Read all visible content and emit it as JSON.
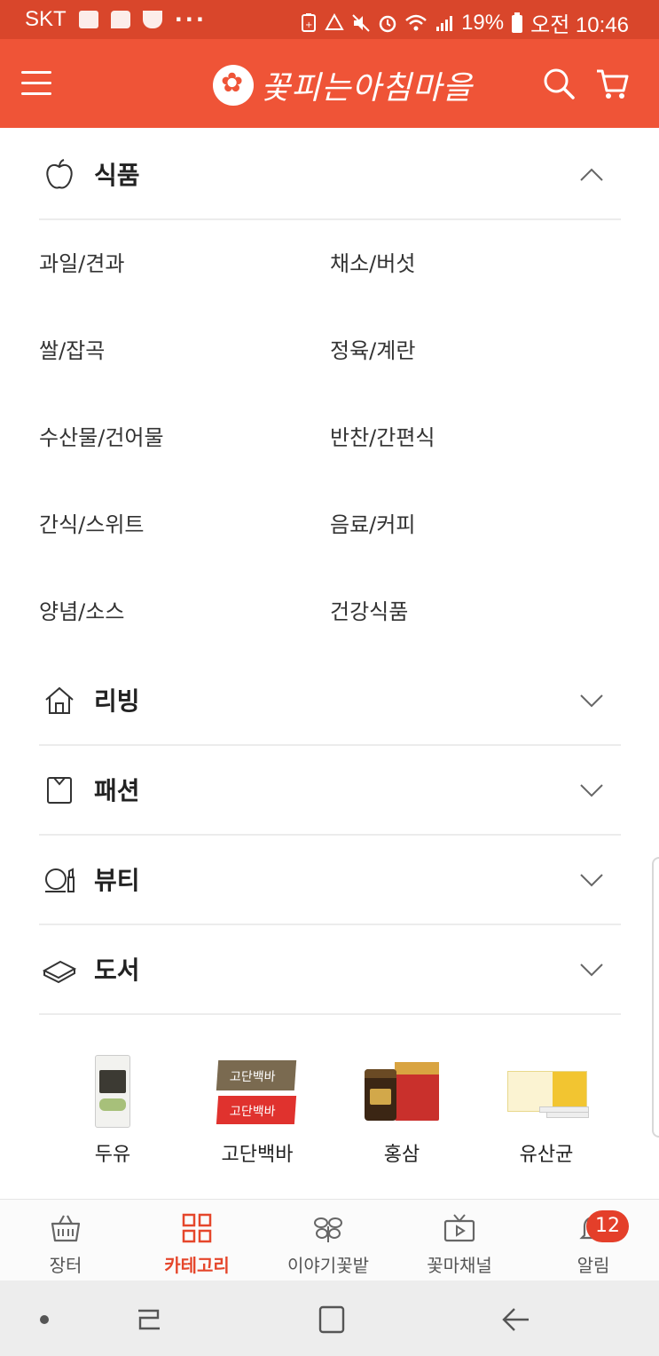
{
  "status_bar": {
    "carrier": "SKT",
    "dots": "···",
    "battery": "19%",
    "time": "오전 10:46"
  },
  "header": {
    "logo_text": "꽃피는아침마을"
  },
  "categories": [
    {
      "label": "식품",
      "icon": "apple-icon",
      "expanded": true,
      "subcategories": [
        "과일/견과",
        "채소/버섯",
        "쌀/잡곡",
        "정육/계란",
        "수산물/건어물",
        "반찬/간편식",
        "간식/스위트",
        "음료/커피",
        "양념/소스",
        "건강식품"
      ]
    },
    {
      "label": "리빙",
      "icon": "house-icon",
      "expanded": false
    },
    {
      "label": "패션",
      "icon": "shirt-icon",
      "expanded": false
    },
    {
      "label": "뷰티",
      "icon": "cosmetics-icon",
      "expanded": false
    },
    {
      "label": "도서",
      "icon": "book-icon",
      "expanded": false
    }
  ],
  "featured": [
    {
      "label": "두유"
    },
    {
      "label": "고단백바"
    },
    {
      "label": "홍삼"
    },
    {
      "label": "유산균"
    }
  ],
  "product_image_text": {
    "bar": "고단백바"
  },
  "bottom_nav": [
    {
      "label": "장터",
      "icon": "basket-icon"
    },
    {
      "label": "카테고리",
      "icon": "grid-icon",
      "active": true
    },
    {
      "label": "이야기꽃밭",
      "icon": "flower-icon"
    },
    {
      "label": "꽃마채널",
      "icon": "tv-icon"
    },
    {
      "label": "알림",
      "icon": "bell-icon",
      "badge": "12"
    }
  ],
  "colors": {
    "status_bar": "#d9462b",
    "header": "#ef5437",
    "accent": "#e5462b"
  }
}
